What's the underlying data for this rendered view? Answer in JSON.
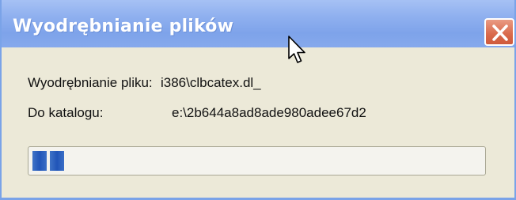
{
  "window": {
    "title": "Wyodrębnianie plików",
    "close_icon": "close-icon",
    "colors": {
      "titlebar": "#8fb0ef",
      "close_button": "#d9694b",
      "dialog_background": "#ece9d8",
      "progress_fill": "#2155b8"
    }
  },
  "extract": {
    "file_label": "Wyodrębnianie pliku:",
    "file_value": "i386\\clbcatex.dl_",
    "dir_label": "Do katalogu:",
    "dir_value": "e:\\2b644a8ad8ade980adee67d2"
  },
  "progress": {
    "fraction": 0.07,
    "segments": 2
  },
  "cursor": {
    "icon": "mouse-pointer-icon"
  }
}
